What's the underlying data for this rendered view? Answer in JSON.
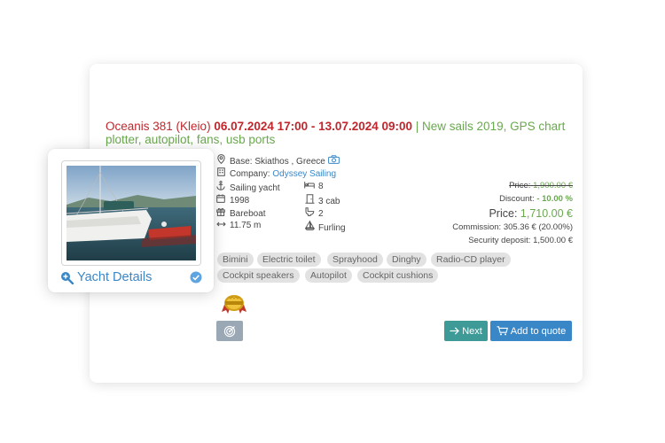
{
  "listing": {
    "name": "Oceanis 381 (Kleio)",
    "dates": "06.07.2024 17:00 - 13.07.2024 09:00",
    "extras": "| New sails 2019, GPS chart plotter, autopilot, fans, usb ports"
  },
  "base": {
    "label": "Base:",
    "location": "Skiathos ,  Greece"
  },
  "company": {
    "label": "Company:",
    "name": "Odyssey Sailing"
  },
  "specs": {
    "type": "Sailing yacht",
    "berths": "8",
    "year": "1998",
    "cabins": "3 cab",
    "charter": "Bareboat",
    "wc": "2",
    "length": "11.75 m",
    "mainsail": "Furling"
  },
  "pricing": {
    "price_label": "Price:",
    "original_price": "1,900.00 €",
    "discount_label": "Discount:",
    "discount_value": "- 10.00 %",
    "final_price": "1,710.00 €",
    "commission": "Commission: 305.36 € (20.00%)",
    "deposit": "Security deposit: 1,500.00 €"
  },
  "equipment": [
    "Bimini",
    "Electric toilet",
    "Sprayhood",
    "Dinghy",
    "Radio-CD player",
    "Cockpit speakers",
    "Autopilot",
    "Cockpit cushions"
  ],
  "actions": {
    "next": "Next",
    "add_to_quote": "Add to quote"
  },
  "yacht_card": {
    "link_label": "Yacht Details"
  },
  "icons": {
    "base": "map-pin-icon",
    "camera": "camera-icon",
    "company": "building-icon",
    "type": "anchor-icon",
    "berths": "bed-icon",
    "year": "calendar-icon",
    "cabins": "door-icon",
    "charter": "gift-icon",
    "wc": "toilet-icon",
    "length": "length-icon",
    "mainsail": "sail-icon"
  },
  "colors": {
    "red": "#c0272d",
    "green": "#6aa84f",
    "blue": "#3a87c8",
    "teal": "#3d9a97",
    "tag_bg": "#e2e2e2"
  }
}
